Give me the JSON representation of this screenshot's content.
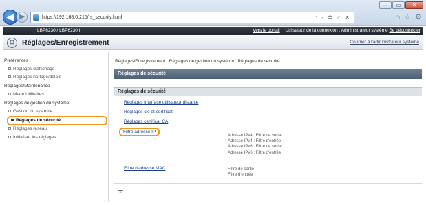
{
  "browser": {
    "url": "https://192.168.0.215/rs_security.html",
    "addr_tools": "ρ - ≙ ♂ ✕",
    "window_buttons": [
      "—",
      "▭",
      "✕"
    ],
    "toolbar_icons": [
      "⌂",
      "☆",
      "⚙"
    ]
  },
  "topbar": {
    "model": "LBP6230 / LBP6230 I",
    "portal": "Vers le portail",
    "user_info": "Utilisateur de la connexion : Administrateur système",
    "logout": "Se déconnecter"
  },
  "titlebar": {
    "title": "Réglages/Enregistrement",
    "mail_admin": "Courrier à l'administrateur système"
  },
  "sidebar": {
    "sections": [
      {
        "label": "Préférences"
      },
      {
        "label": "Réglages/Maintenance"
      },
      {
        "label": "Réglages de gestion du système"
      }
    ],
    "items": [
      {
        "label": "Réglages d'affichage"
      },
      {
        "label": "Réglages horloge/délais"
      },
      {
        "label": "Menu Utilitaires"
      },
      {
        "label": "Gestion du système"
      },
      {
        "label": "Réglages de sécurité"
      },
      {
        "label": "Réglages réseau"
      },
      {
        "label": "Initialiser les réglages"
      }
    ]
  },
  "main": {
    "breadcrumb": "Réglages/Enregistrement : Réglages de gestion du système : Réglages de sécurité",
    "header": "Réglages de sécurité",
    "subheader": "Réglages de sécurité",
    "links": [
      {
        "label": "Réglages interface utilisateur distante"
      },
      {
        "label": "Réglages clé et certificat"
      },
      {
        "label": "Réglages certificat CA"
      },
      {
        "label": "Filtre adresse IP"
      },
      {
        "label": "Filtre d'adresse MAC"
      }
    ],
    "ip_filters": [
      "Adresse IPv4 : Filtre de sortie",
      "Adresse IPv4 : Filtre d'entrée",
      "Adresse IPv6 : Filtre de sortie",
      "Adresse IPv6 : Filtre d'entrée"
    ],
    "mac_filters": [
      "Filtre de sortie",
      "Filtre d'entrée"
    ]
  }
}
